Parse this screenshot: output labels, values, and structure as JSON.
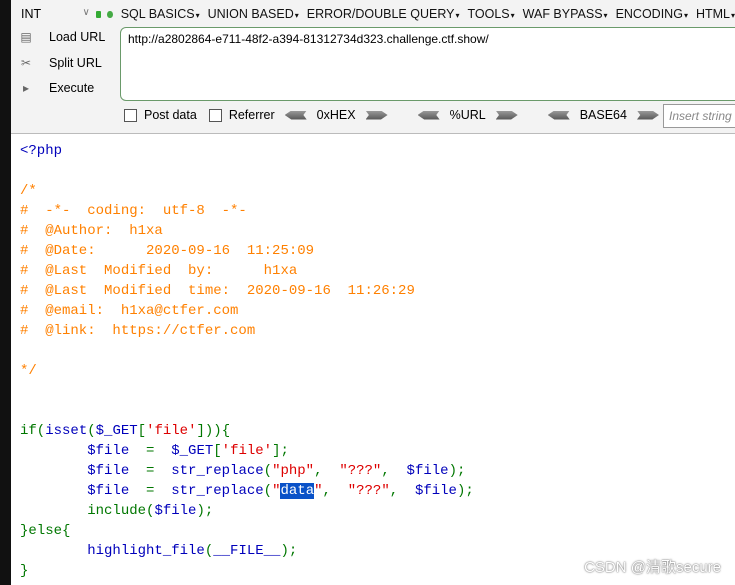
{
  "toolbar": {
    "select_value": "INT",
    "menus": [
      "SQL BASICS",
      "UNION BASED",
      "ERROR/DOUBLE QUERY",
      "TOOLS",
      "WAF BYPASS",
      "ENCODING",
      "HTML"
    ],
    "load_url": "Load URL",
    "split_url": "Split URL",
    "execute": "Execute",
    "url": "http://a2802864-e711-48f2-a394-81312734d323.challenge.ctf.show/",
    "post_data": "Post data",
    "referrer": "Referrer",
    "hex": "0xHEX",
    "urlenc": "%URL",
    "base64": "BASE64",
    "insert_placeholder": "Insert string"
  },
  "code": [
    [
      [
        "<?php",
        "d"
      ]
    ],
    [],
    [
      [
        "/*",
        "c"
      ]
    ],
    [
      [
        "#  -*-  coding:  utf-8  -*-",
        "c"
      ]
    ],
    [
      [
        "#  @Author:  h1xa",
        "c"
      ]
    ],
    [
      [
        "#  @Date:      2020-09-16  11:25:09",
        "c"
      ]
    ],
    [
      [
        "#  @Last  Modified  by:      h1xa",
        "c"
      ]
    ],
    [
      [
        "#  @Last  Modified  time:  2020-09-16  11:26:29",
        "c"
      ]
    ],
    [
      [
        "#  @email:  h1xa@ctfer.com",
        "c"
      ]
    ],
    [
      [
        "#  @link:  https://ctfer.com",
        "c"
      ]
    ],
    [],
    [
      [
        "*/",
        "c"
      ]
    ],
    [],
    [],
    [
      [
        "if(",
        "k"
      ],
      [
        "isset",
        "d"
      ],
      [
        "(",
        "k"
      ],
      [
        "$_GET",
        "d"
      ],
      [
        "[",
        "k"
      ],
      [
        "'file'",
        "s"
      ],
      [
        "])){",
        "k"
      ]
    ],
    [
      [
        "        ",
        ""
      ],
      [
        "$file",
        "d"
      ],
      [
        "  =  ",
        "k"
      ],
      [
        "$_GET",
        "d"
      ],
      [
        "[",
        "k"
      ],
      [
        "'file'",
        "s"
      ],
      [
        "];",
        "k"
      ]
    ],
    [
      [
        "        ",
        ""
      ],
      [
        "$file",
        "d"
      ],
      [
        "  =  ",
        "k"
      ],
      [
        "str_replace",
        "d"
      ],
      [
        "(",
        "k"
      ],
      [
        "\"php\"",
        "s"
      ],
      [
        ",  ",
        "k"
      ],
      [
        "\"???\"",
        "s"
      ],
      [
        ",  ",
        "k"
      ],
      [
        "$file",
        "d"
      ],
      [
        ");",
        "k"
      ]
    ],
    [
      [
        "        ",
        ""
      ],
      [
        "$file",
        "d"
      ],
      [
        "  =  ",
        "k"
      ],
      [
        "str_replace",
        "d"
      ],
      [
        "(",
        "k"
      ],
      [
        "\"",
        "s"
      ],
      [
        "data",
        "h"
      ],
      [
        "\"",
        "s"
      ],
      [
        ",  ",
        "k"
      ],
      [
        "\"???\"",
        "s"
      ],
      [
        ",  ",
        "k"
      ],
      [
        "$file",
        "d"
      ],
      [
        ");",
        "k"
      ]
    ],
    [
      [
        "        ",
        ""
      ],
      [
        "include(",
        "k"
      ],
      [
        "$file",
        "d"
      ],
      [
        ");",
        "k"
      ]
    ],
    [
      [
        "}else{",
        "k"
      ]
    ],
    [
      [
        "        ",
        ""
      ],
      [
        "highlight_file",
        "d"
      ],
      [
        "(",
        "k"
      ],
      [
        "__FILE__",
        "d"
      ],
      [
        ");",
        "k"
      ]
    ],
    [
      [
        "}",
        "k"
      ]
    ]
  ],
  "watermark": "CSDN @清歌secure"
}
